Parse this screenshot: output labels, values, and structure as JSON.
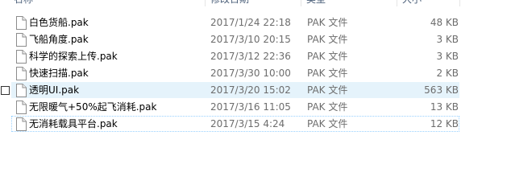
{
  "columns": {
    "name": "名称",
    "date": "修改日期",
    "type": "类型",
    "size": "大小"
  },
  "files": [
    {
      "name": "白色货船.pak",
      "date": "2017/1/24 22:18",
      "type": "PAK 文件",
      "size": "48 KB"
    },
    {
      "name": "飞船角度.pak",
      "date": "2017/3/10 20:15",
      "type": "PAK 文件",
      "size": "3 KB"
    },
    {
      "name": "科学的探索上传.pak",
      "date": "2017/3/12 22:36",
      "type": "PAK 文件",
      "size": "3 KB"
    },
    {
      "name": "快速扫描.pak",
      "date": "2017/3/30 10:00",
      "type": "PAK 文件",
      "size": "2 KB"
    },
    {
      "name": "透明UI.pak",
      "date": "2017/3/20 15:02",
      "type": "PAK 文件",
      "size": "563 KB"
    },
    {
      "name": "无限暖气+50%起飞消耗.pak",
      "date": "2017/3/16 11:05",
      "type": "PAK 文件",
      "size": "13 KB"
    },
    {
      "name": "无消耗载具平台.pak",
      "date": "2017/3/15 4:24",
      "type": "PAK 文件",
      "size": "12 KB"
    }
  ],
  "hovered_index": 4,
  "focused_index": 6,
  "icon": "file-icon"
}
